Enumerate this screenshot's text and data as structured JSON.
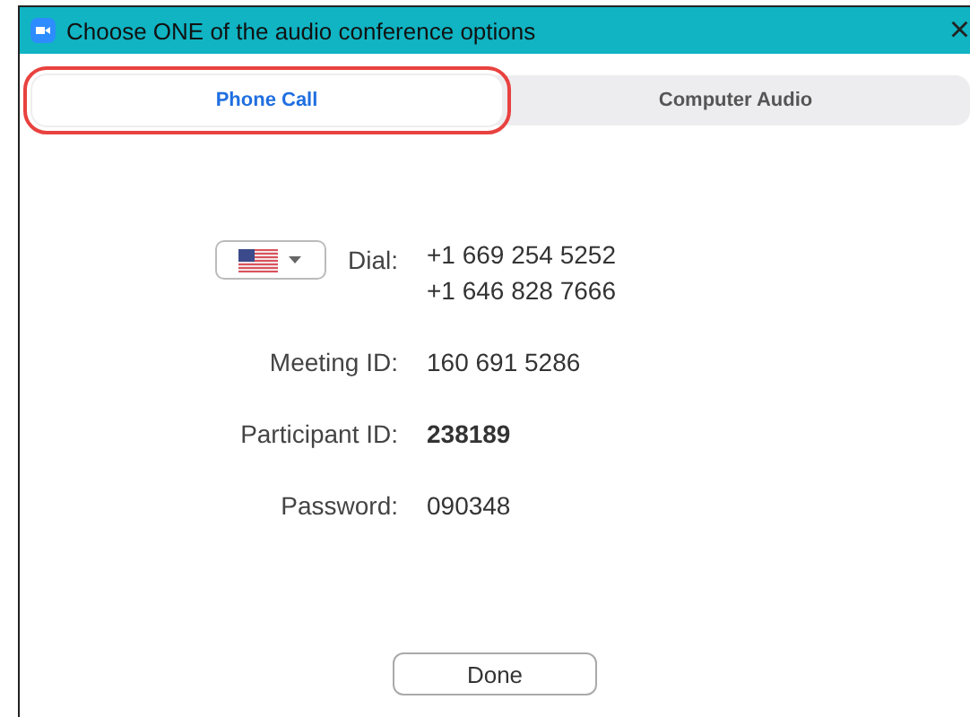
{
  "window": {
    "title": "Choose ONE of the audio conference options",
    "close": "×"
  },
  "tabs": [
    {
      "label": "Phone Call",
      "selected": true,
      "highlighted": true
    },
    {
      "label": "Computer Audio",
      "selected": false,
      "highlighted": false
    }
  ],
  "dial": {
    "label": "Dial:",
    "numbers": [
      "+1 669 254 5252",
      "+1 646 828 7666"
    ]
  },
  "fields": [
    {
      "label": "Meeting ID:",
      "value": "160 691 5286",
      "bold": false
    },
    {
      "label": "Participant ID:",
      "value": "238189",
      "bold": true
    },
    {
      "label": "Password:",
      "value": "090348",
      "bold": false
    }
  ],
  "buttons": [
    "Done"
  ]
}
